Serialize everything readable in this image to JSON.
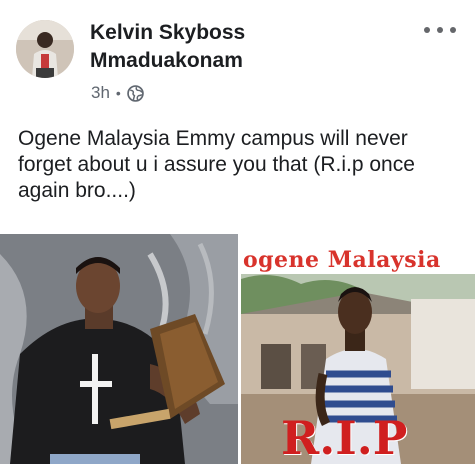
{
  "post": {
    "author_line1": "Kelvin Skyboss",
    "author_line2": "Mmaduakonam",
    "time": "3h",
    "separator": "•",
    "privacy_icon": "globe-icon",
    "more_icon": "more-options-icon",
    "body_text": "Ogene Malaysia Emmy campus will never forget about u i assure you that (R.i.p once again bro....)"
  },
  "photos": {
    "right_overlay_title": "ogene Malaysia",
    "right_overlay_rip": "R.I.P"
  },
  "colors": {
    "text": "#1c1e21",
    "secondary_text": "#606770",
    "overlay_red": "#d8332c"
  }
}
